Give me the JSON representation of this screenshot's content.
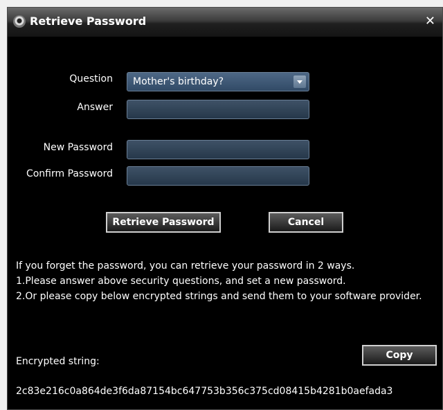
{
  "window": {
    "title": "Retrieve Password"
  },
  "form": {
    "question_label": "Question",
    "question_value": "Mother's birthday?",
    "answer_label": "Answer",
    "new_password_label": "New Password",
    "confirm_password_label": "Confirm Password"
  },
  "buttons": {
    "retrieve": "Retrieve Password",
    "cancel": "Cancel",
    "copy": "Copy"
  },
  "info": {
    "line1": "If you forget the password, you can retrieve your password in 2 ways.",
    "line2": "1.Please answer above security questions, and set a new password.",
    "line3": "2.Or please copy below encrypted strings and send them to your software provider."
  },
  "encrypted": {
    "label": "Encrypted string:",
    "value": "2c83e216c0a864de3f6da87154bc647753b356c375cd08415b4281b0aefada3"
  },
  "icons": {
    "app": "camera-icon",
    "close": "close-icon"
  }
}
